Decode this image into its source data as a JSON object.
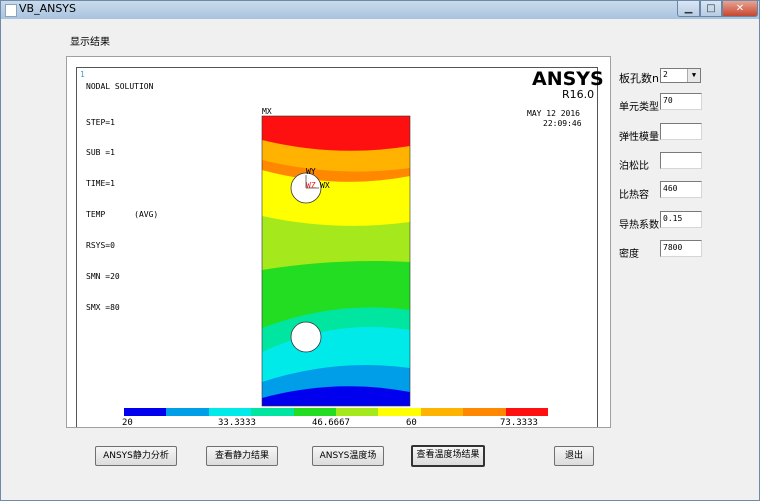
{
  "window": {
    "title": "VB_ANSYS"
  },
  "header": {
    "label": "显示结果"
  },
  "plot": {
    "solution_title": "NODAL SOLUTION",
    "info_lines": [
      "STEP=1",
      "SUB =1",
      "TIME=1",
      "TEMP      (AVG)",
      "RSYS=0",
      "SMN =20",
      "SMX =80"
    ],
    "logo": "ANSYS",
    "version": "R16.0",
    "date": "MAY 12 2016",
    "time": "22:09:46",
    "mx_label": "MX",
    "axis_wy": "WY",
    "axis_wz": "WZ",
    "axis_wx": "WX",
    "corner_mark": "1",
    "legend_ticks": [
      "20",
      "33.3333",
      "46.6667",
      "60",
      "73.3333"
    ],
    "legend_colors": [
      "#0000ee",
      "#009de8",
      "#00eaea",
      "#00e6a0",
      "#22dd22",
      "#a5e81b",
      "#ffff00",
      "#ffb300",
      "#ff8800",
      "#ff1010"
    ]
  },
  "params": {
    "hole_count_label": "板孔数n:",
    "hole_count_value": "2",
    "element_type_label": "单元类型",
    "element_type_value": "70",
    "elastic_modulus_label": "弹性模量",
    "elastic_modulus_value": "",
    "poisson_label": "泊松比",
    "poisson_value": "",
    "specific_heat_label": "比热容",
    "specific_heat_value": "460",
    "conductivity_label": "导热系数",
    "conductivity_value": "0.15",
    "density_label": "密度",
    "density_value": "7800"
  },
  "buttons": {
    "static_analysis": "ANSYS静力分析",
    "static_results": "查看静力结果",
    "thermal_field": "ANSYS温度场",
    "thermal_results": "查看温度场结果",
    "exit": "退出"
  }
}
